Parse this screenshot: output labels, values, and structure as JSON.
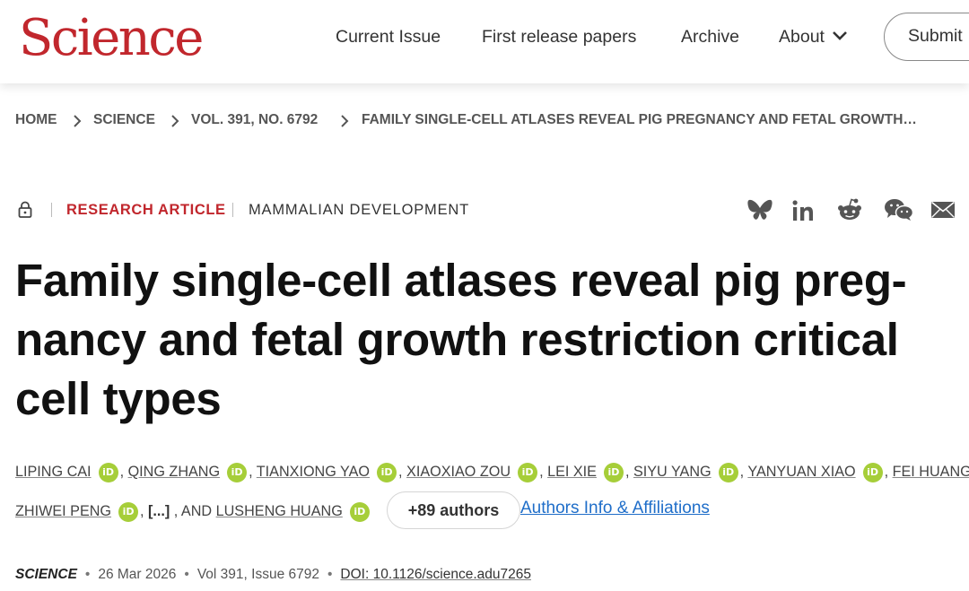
{
  "header": {
    "logo": "Science",
    "nav": [
      "Current Issue",
      "First release papers",
      "Archive",
      "About"
    ],
    "submit_label": "Submit"
  },
  "breadcrumb": [
    "HOME",
    "SCIENCE",
    "VOL. 391, NO. 6792",
    "FAMILY SINGLE-CELL ATLASES REVEAL PIG PREGNANCY AND FETAL GROWTH…"
  ],
  "article": {
    "type": "RESEARCH ARTICLE",
    "subject": "MAMMALIAN DEVELOPMENT",
    "title_lines": [
      "Family single-cell atlases reveal pig preg-",
      "nancy and fetal growth restriction critical",
      "cell types"
    ],
    "share_icons": [
      "bluesky-icon",
      "linkedin-icon",
      "reddit-icon",
      "wechat-icon",
      "email-icon"
    ]
  },
  "authors": {
    "line1": [
      "LIPING CAI",
      "QING ZHANG",
      "TIANXIONG YAO",
      "XIAOXIAO ZOU",
      "LEI XIE",
      "SIYU YANG",
      "YANYUAN XIAO",
      "FEI HUANG"
    ],
    "line2_first": "ZHIWEI PENG",
    "ellipsis": "[...]",
    "and_text": "AND",
    "last": "LUSHENG HUANG",
    "orcid_label": "iD",
    "more_button": "+89 authors",
    "affiliations_link": "Authors Info & Affiliations"
  },
  "citation": {
    "journal": "SCIENCE",
    "date": "26 Mar 2026",
    "volume": "Vol 391, Issue 6792",
    "doi": "DOI: 10.1126/science.adu7265"
  },
  "colors": {
    "brand": "#c1272d",
    "orcid": "#a6ce39",
    "link": "#1f6ec9"
  }
}
